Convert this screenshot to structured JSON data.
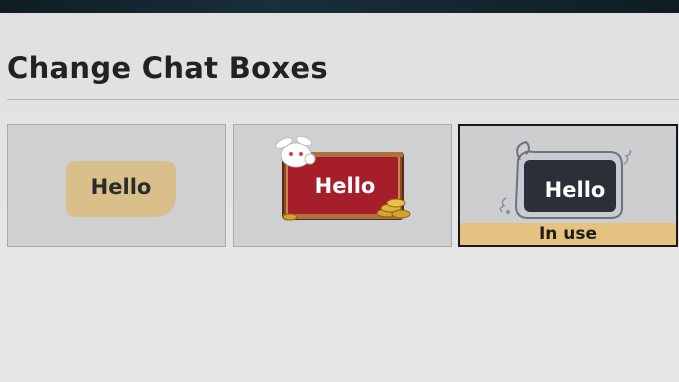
{
  "panel": {
    "title": "Change Chat Boxes"
  },
  "chat_boxes": [
    {
      "label": "Hello",
      "style": "beige-rounded",
      "selected": false
    },
    {
      "label": "Hello",
      "style": "red-chest-with-bunny",
      "selected": false
    },
    {
      "label": "Hello",
      "style": "dark-frame",
      "selected": true
    }
  ],
  "status": {
    "in_use_label": "In use"
  },
  "colors": {
    "beige_bubble": "#d9bf8a",
    "red_bubble": "#a61e2a",
    "dark_bubble": "#2a2f38",
    "in_use_bar": "#e5c27f",
    "selected_border": "#16191c"
  }
}
